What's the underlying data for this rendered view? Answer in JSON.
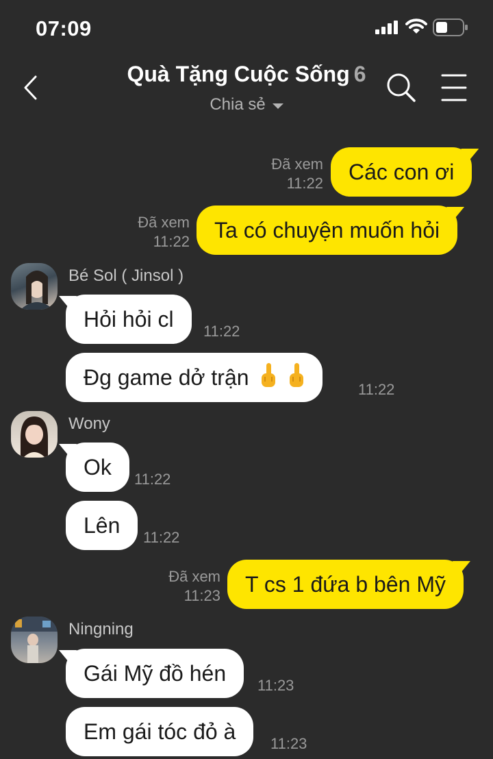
{
  "status_bar": {
    "time": "07:09"
  },
  "header": {
    "title": "Quà Tặng Cuộc Sống",
    "member_count": "6",
    "subtitle": "Chia sẻ"
  },
  "icons": {
    "back": "chevron-left-icon",
    "search": "search-icon",
    "menu": "hamburger-menu-icon",
    "subtitle_dropdown": "chevron-down-icon",
    "emoji": "middle-finger-emoji"
  },
  "colors": {
    "background": "#2b2b2b",
    "outgoing_bubble": "#fee500",
    "incoming_bubble": "#ffffff",
    "meta_text": "#9a9a9a"
  },
  "messages": [
    {
      "direction": "out",
      "text": "Các con ơi",
      "read_label": "Đã xem",
      "time": "11:22"
    },
    {
      "direction": "out",
      "text": "Ta có chuyện muốn hỏi",
      "read_label": "Đã xem",
      "time": "11:22"
    },
    {
      "direction": "in",
      "sender": "Bé Sol ( Jinsol )",
      "text": "Hỏi hỏi cl",
      "time": "11:22"
    },
    {
      "direction": "in",
      "text": "Đg game dở trận",
      "emoji_count": 2,
      "time": "11:22"
    },
    {
      "direction": "in",
      "sender": "Wony",
      "text": "Ok",
      "time": "11:22"
    },
    {
      "direction": "in",
      "text": "Lên",
      "time": "11:22"
    },
    {
      "direction": "out",
      "text": "T cs 1 đứa b bên Mỹ",
      "read_label": "Đã xem",
      "time": "11:23"
    },
    {
      "direction": "in",
      "sender": "Ningning",
      "text": "Gái Mỹ đồ hén",
      "time": "11:23"
    },
    {
      "direction": "in",
      "text": "Em gái tóc đỏ à",
      "time": "11:23"
    }
  ]
}
